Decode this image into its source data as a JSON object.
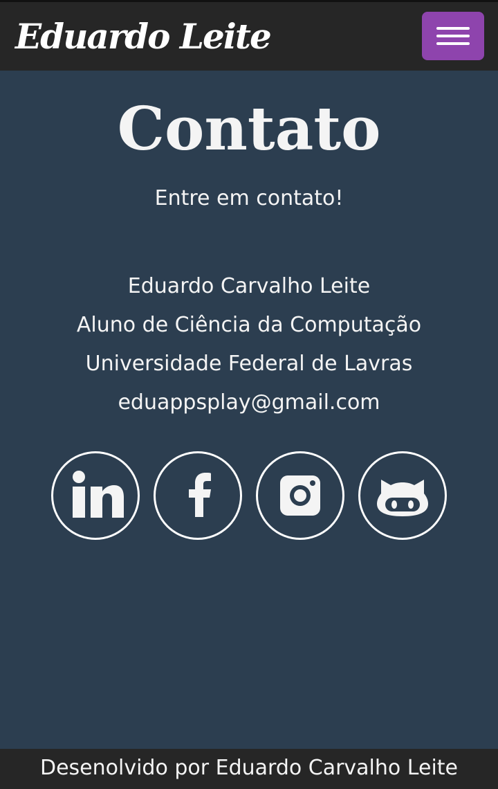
{
  "navbar": {
    "brand": "Eduardo Leite",
    "menu_icon": "hamburger-menu-icon",
    "accent_color": "#8e44ad"
  },
  "main": {
    "title": "Contato",
    "subtitle": "Entre em contato!",
    "info": [
      "Eduardo Carvalho Leite",
      "Aluno de Ciência da Computação",
      "Universidade Federal de Lavras",
      "eduappsplay@gmail.com"
    ],
    "socials": [
      {
        "icon": "linkedin-icon"
      },
      {
        "icon": "facebook-icon"
      },
      {
        "icon": "instagram-icon"
      },
      {
        "icon": "github-icon"
      }
    ]
  },
  "footer": {
    "text": "Desenolvido por Eduardo Carvalho Leite"
  },
  "colors": {
    "background": "#2c3e50",
    "navbar": "#262626",
    "text": "#f4f4f4"
  }
}
